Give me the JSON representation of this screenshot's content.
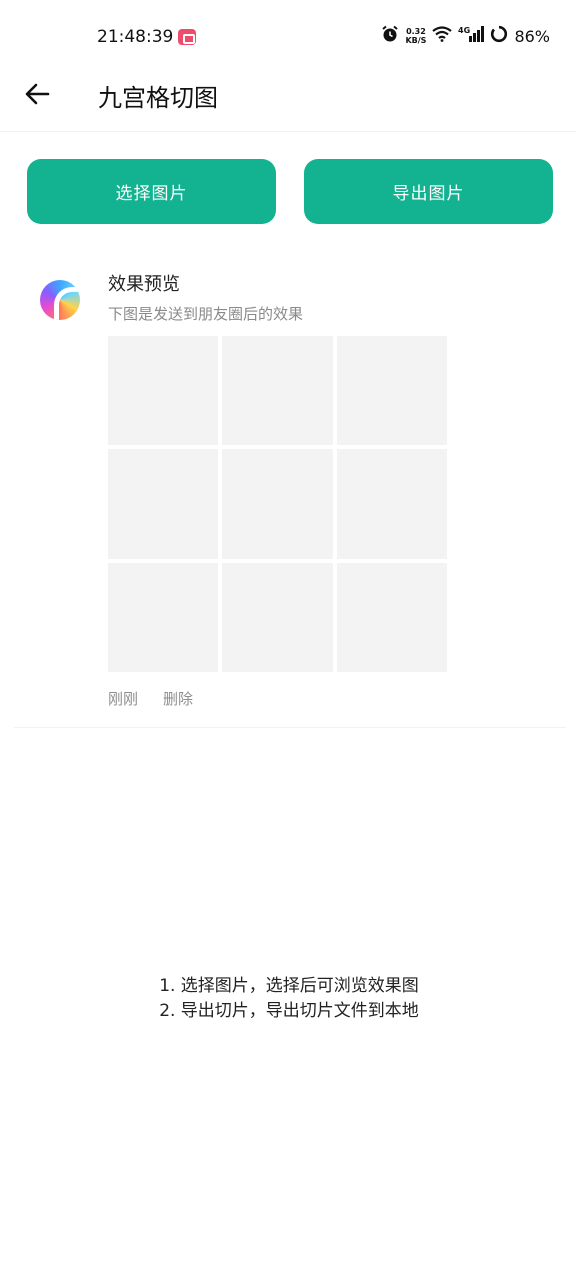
{
  "status_bar": {
    "time": "21:48:39",
    "net_speed_value": "0.32",
    "net_speed_unit": "KB/S",
    "battery_percent": "86%",
    "icons": [
      "alarm-icon",
      "wifi-icon",
      "signal-4g-icon",
      "battery-ring-icon"
    ]
  },
  "appbar": {
    "back_icon": "arrow-left-icon",
    "title": "九宫格切图"
  },
  "actions": {
    "select_label": "选择图片",
    "export_label": "导出图片"
  },
  "preview": {
    "name": "效果预览",
    "description": "下图是发送到朋友圈后的效果",
    "grid_cells": 9,
    "time": "刚刚",
    "delete_label": "删除"
  },
  "instructions": {
    "line1": "1. 选择图片，选择后可浏览效果图",
    "line2": "2. 导出切片，导出切片文件到本地"
  },
  "colors": {
    "accent": "#13b391",
    "muted_text": "#8a8a8a",
    "placeholder": "#f3f3f3"
  }
}
